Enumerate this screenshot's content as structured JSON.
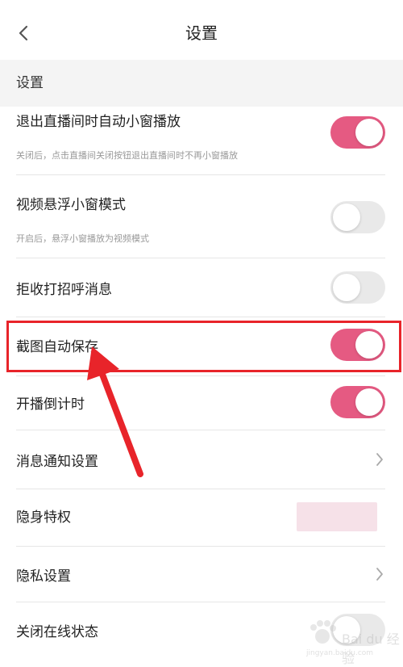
{
  "header": {
    "title": "设置"
  },
  "section": {
    "label": "设置"
  },
  "rows": [
    {
      "label": "退出直播间时自动小窗播放",
      "desc": "关闭后，点击直播间关闭按钮退出直播间时不再小窗播放",
      "control": "toggle",
      "on": true
    },
    {
      "label": "视频悬浮小窗模式",
      "desc": "开启后，悬浮小窗播放为视频模式",
      "control": "toggle",
      "on": false
    },
    {
      "label": "拒收打招呼消息",
      "control": "toggle",
      "on": false
    },
    {
      "label": "截图自动保存",
      "control": "toggle",
      "on": true
    },
    {
      "label": "开播倒计时",
      "control": "toggle",
      "on": true
    },
    {
      "label": "消息通知设置",
      "control": "chevron"
    },
    {
      "label": "隐身特权",
      "control": "pink-block"
    },
    {
      "label": "隐私设置",
      "control": "chevron"
    },
    {
      "label": "关闭在线状态",
      "control": "toggle",
      "on": false
    }
  ],
  "watermark": {
    "text": "Bai du 经验",
    "sub": "jingyan.baidu.com"
  },
  "colors": {
    "toggle_on": "#e55a82",
    "toggle_off": "#e9e9e9",
    "highlight": "#e8242a"
  }
}
